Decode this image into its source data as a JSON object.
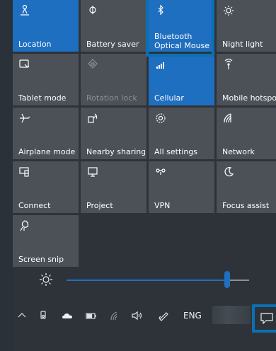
{
  "tiles": {
    "location": "Location",
    "battery_saver": "Battery saver",
    "bluetooth_line1": "Bluetooth",
    "bluetooth_line2": "Optical Mouse",
    "night_light": "Night light",
    "tablet_mode": "Tablet mode",
    "rotation_lock": "Rotation lock",
    "cellular": "Cellular",
    "mobile_hotspot": "Mobile hotspo",
    "airplane_mode": "Airplane mode",
    "nearby_sharing": "Nearby sharing",
    "all_settings": "All settings",
    "network": "Network",
    "connect": "Connect",
    "project": "Project",
    "vpn": "VPN",
    "focus_assist": "Focus assist",
    "screen_snip": "Screen snip"
  },
  "brightness": {
    "level_fraction": 0.88
  },
  "taskbar": {
    "language": "ENG"
  },
  "colors": {
    "accent": "#1f6fc0",
    "highlight": "#0b6fb4",
    "tile": "#4b5157",
    "panel": "#2d3339"
  }
}
